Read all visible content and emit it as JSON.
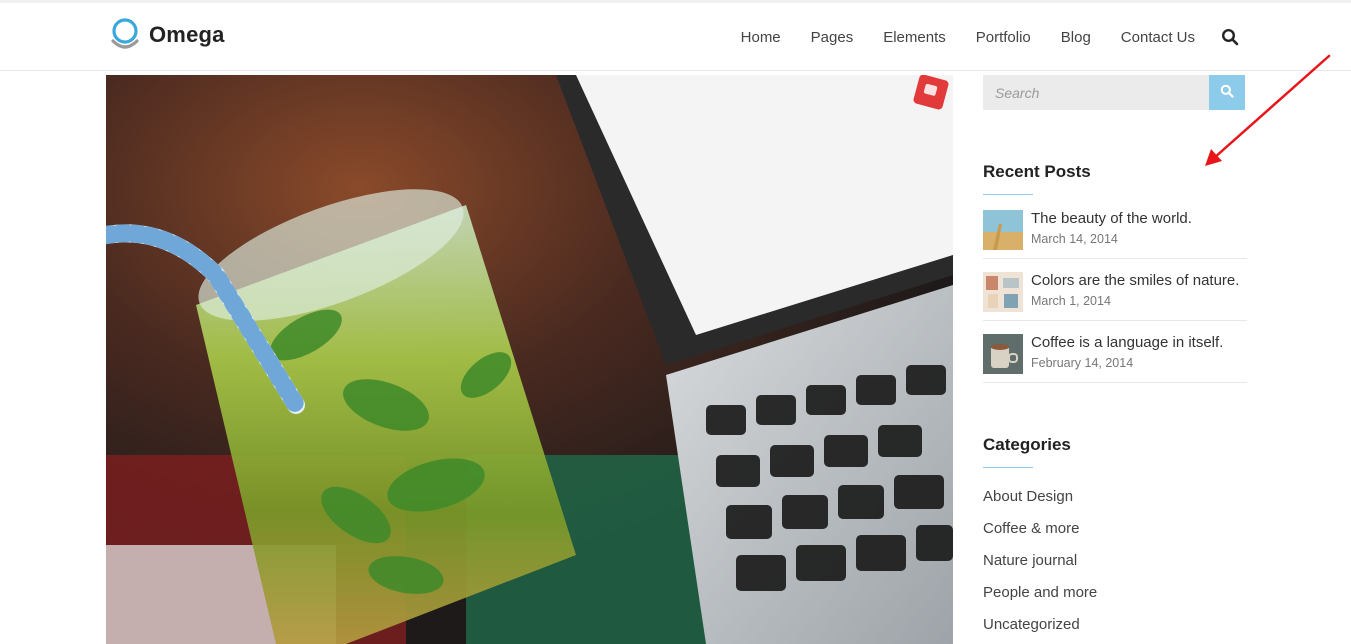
{
  "header": {
    "brand": "Omega",
    "nav": [
      {
        "label": "Home"
      },
      {
        "label": "Pages"
      },
      {
        "label": "Elements"
      },
      {
        "label": "Portfolio"
      },
      {
        "label": "Blog"
      },
      {
        "label": "Contact Us"
      }
    ],
    "search_icon": "search-icon"
  },
  "sidebar": {
    "search": {
      "placeholder": "Search"
    },
    "recent_posts": {
      "title": "Recent Posts",
      "posts": [
        {
          "title": "The beauty of the world.",
          "date": "March 14, 2014"
        },
        {
          "title": "Colors are the smiles of nature.",
          "date": "March 1, 2014"
        },
        {
          "title": "Coffee is a language in itself.",
          "date": "February 14, 2014"
        }
      ]
    },
    "categories": {
      "title": "Categories",
      "items": [
        "About Design",
        "Coffee & more",
        "Nature journal",
        "People and more",
        "Uncategorized"
      ]
    }
  },
  "colors": {
    "accent": "#8ccbea",
    "annotation_arrow": "#e8161b"
  }
}
